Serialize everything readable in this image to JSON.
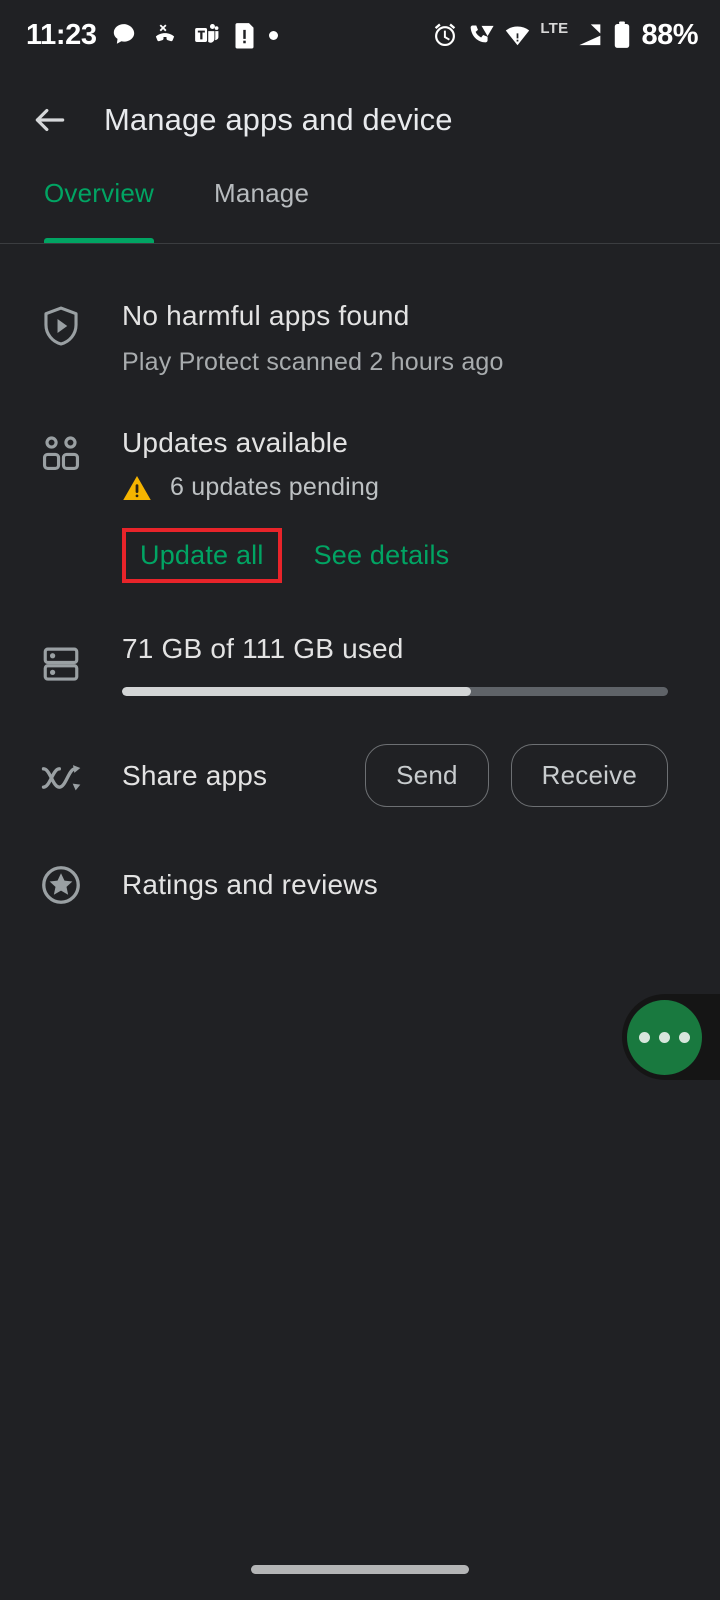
{
  "status_bar": {
    "time": "11:23",
    "battery_percent": "88%",
    "network_type": "LTE",
    "left_icons": [
      "chat-bubble-icon",
      "missed-call-icon",
      "microsoft-teams-icon",
      "sim-card-alert-icon",
      "more-notifications-dot-icon"
    ],
    "right_icons": [
      "alarm-clock-icon",
      "wifi-calling-icon",
      "wifi-icon",
      "signal-bars-icon",
      "battery-icon"
    ]
  },
  "app_bar": {
    "back_icon": "back-arrow-icon",
    "title": "Manage apps and device"
  },
  "tabs": [
    {
      "label": "Overview",
      "active": true
    },
    {
      "label": "Manage",
      "active": false
    }
  ],
  "rows": {
    "play_protect": {
      "icon": "play-protect-shield-icon",
      "title": "No harmful apps found",
      "subtitle": "Play Protect scanned 2 hours ago"
    },
    "updates": {
      "icon": "apps-grid-icon",
      "title": "Updates available",
      "warning_icon": "warning-triangle-icon",
      "pending": "6 updates pending",
      "update_all_label": "Update all",
      "see_details_label": "See details",
      "highlighted_action": "Update all"
    },
    "storage": {
      "icon": "storage-stack-icon",
      "title": "71 GB of 111 GB used",
      "used_gb": 71,
      "total_gb": 111,
      "used_percent": 64
    },
    "share": {
      "icon": "share-apps-icon",
      "label": "Share apps",
      "send_label": "Send",
      "receive_label": "Receive"
    },
    "ratings": {
      "icon": "star-circle-icon",
      "label": "Ratings and reviews"
    }
  },
  "fab": {
    "icon": "more-options-dots-icon"
  },
  "colors": {
    "background": "#202124",
    "accent_green": "#01a463",
    "highlight_red": "#e8242a",
    "warning_amber": "#f5b400",
    "fab_green": "#19793f"
  }
}
